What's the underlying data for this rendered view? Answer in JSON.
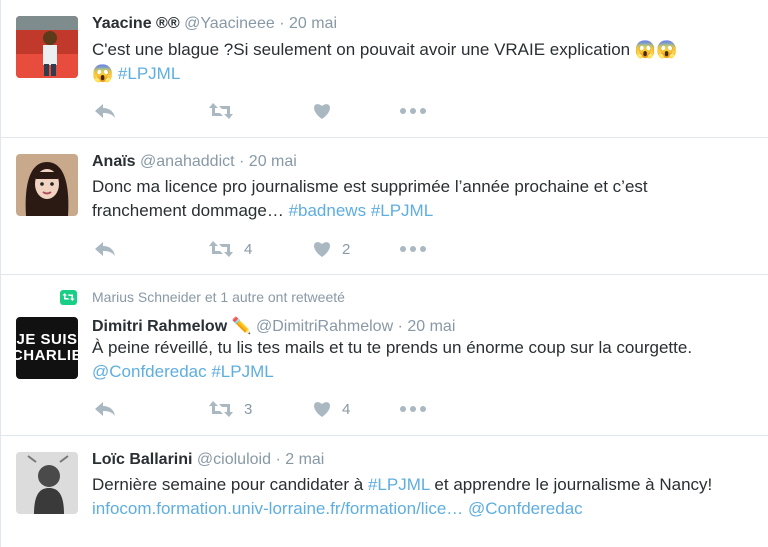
{
  "tweets": [
    {
      "name": "Yaacine ®®",
      "handle": "@Yaacineee",
      "time": "20 mai",
      "text": "C'est une blague ?Si seulement on  pouvait avoir une VRAIE explication",
      "emoji": "😱😱",
      "emoji2": "😱",
      "hashtag": "#LPJML",
      "retweets": "",
      "likes": ""
    },
    {
      "name": "Anaïs",
      "handle": "@anahaddict",
      "time": "20 mai",
      "text": "Donc ma licence pro journalisme est supprimée l’année prochaine et c’est franchement dommage…",
      "hashtag1": "#badnews",
      "hashtag2": "#LPJML",
      "retweets": "4",
      "likes": "2"
    },
    {
      "retweet_context": "Marius Schneider et 1 autre ont retweeté",
      "name": "Dimitri Rahmelow",
      "name_emoji": "✏️",
      "handle": "@DimitriRahmelow",
      "time": "20 mai",
      "avatar_text_line1": "JE SUIS",
      "avatar_text_line2": "CHARLIE",
      "text": "À peine réveillé, tu lis tes mails et tu te prends un énorme coup sur la courgette.",
      "mention": "@Confderedac",
      "hashtag": "#LPJML",
      "retweets": "3",
      "likes": "4"
    },
    {
      "name": "Loïc Ballarini",
      "handle": "@cioluloid",
      "time": "2 mai",
      "text_before": "Dernière semaine pour candidater à",
      "hashtag": "#LPJML",
      "text_after": "et apprendre le journalisme à Nancy!",
      "url": "infocom.formation.univ-lorraine.fr/formation/lice…",
      "mention": "@Confderedac"
    }
  ],
  "separator": "·",
  "colors": {
    "link": "#5eaee0",
    "meta": "#8899a6",
    "icon": "#aab8c2",
    "retweet_badge": "#19cf86",
    "divider": "#e1e8ed"
  },
  "icons": [
    "reply-icon",
    "retweet-icon",
    "heart-icon",
    "more-icon",
    "retweet-badge-icon",
    "pencil-emoji"
  ]
}
